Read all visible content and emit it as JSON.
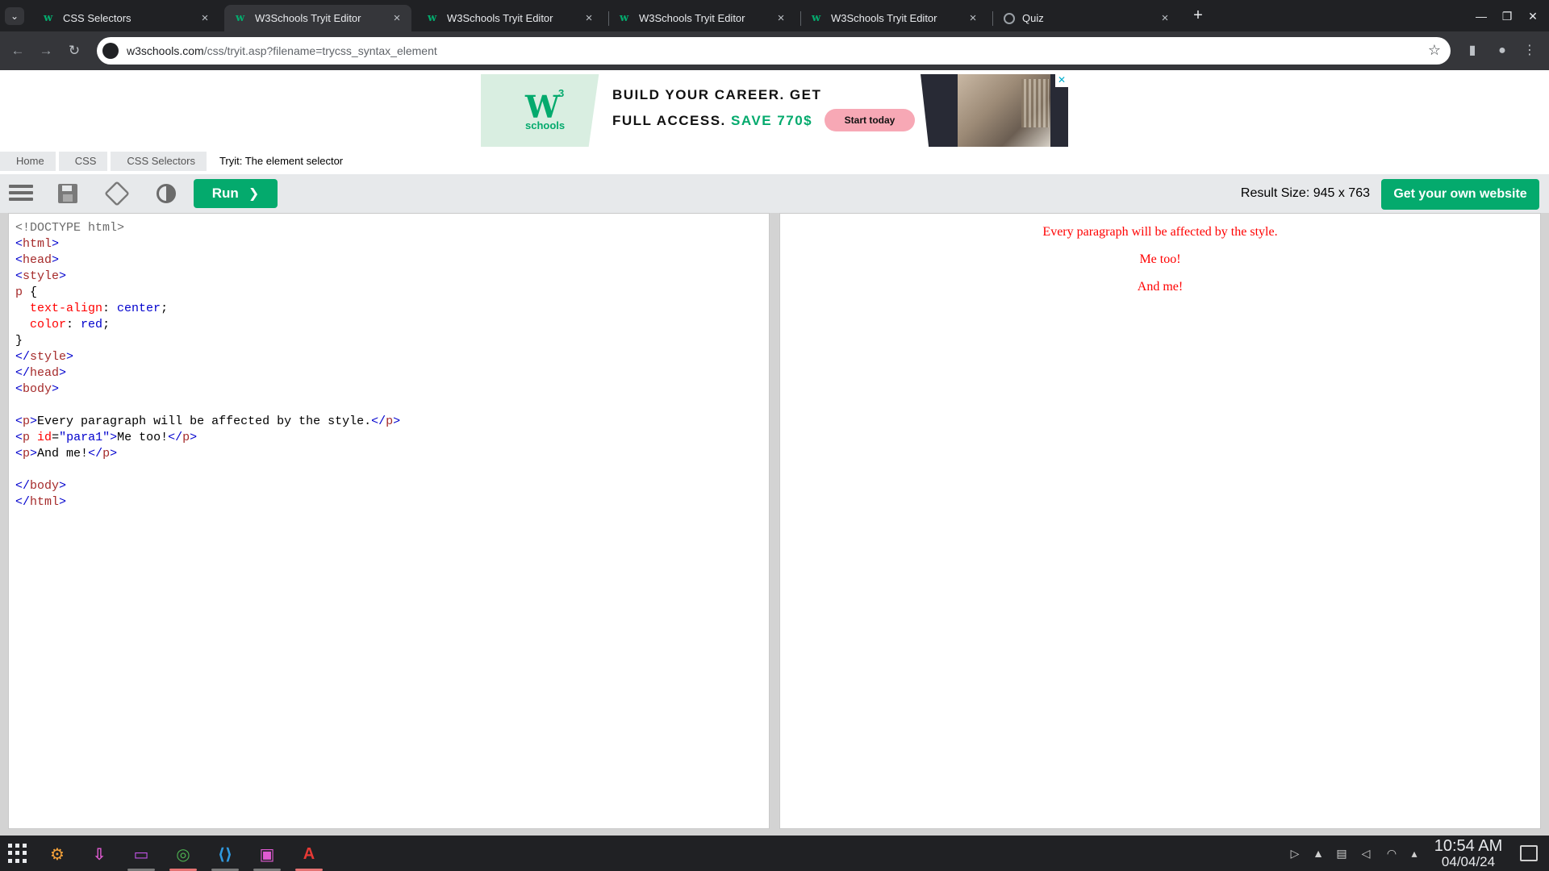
{
  "browser": {
    "tabs": [
      {
        "title": "CSS Selectors",
        "favicon": "w3schools-icon",
        "active": false
      },
      {
        "title": "W3Schools Tryit Editor",
        "favicon": "w3schools-icon",
        "active": true
      },
      {
        "title": "W3Schools Tryit Editor",
        "favicon": "w3schools-icon",
        "active": false
      },
      {
        "title": "W3Schools Tryit Editor",
        "favicon": "w3schools-icon",
        "active": false
      },
      {
        "title": "W3Schools Tryit Editor",
        "favicon": "w3schools-icon",
        "active": false
      },
      {
        "title": "Quiz",
        "favicon": "globe-icon",
        "active": false
      }
    ],
    "tab_close_glyph": "×",
    "new_tab_glyph": "+",
    "url_domain": "w3schools.com",
    "url_path": "/css/tryit.asp?filename=trycss_syntax_element"
  },
  "ad": {
    "logo_mark": "W",
    "logo_superscript": "3",
    "logo_text": "schools",
    "headline_line1": "BUILD YOUR CAREER. GET",
    "headline_line2_prefix": "FULL ACCESS.",
    "headline_line2_highlight": "SAVE 770$",
    "cta_label": "Start today",
    "close_glyph": "✕",
    "accent_color": "#04aa6d"
  },
  "breadcrumb": {
    "items": [
      "Home",
      "CSS",
      "CSS Selectors"
    ],
    "current": "Tryit: The element selector"
  },
  "tryit": {
    "run_label": "Run",
    "run_chevron": "❯",
    "result_size": "Result Size: 945 x 763",
    "get_website_label": "Get your own website",
    "brand_color": "#04aa6d"
  },
  "code": {
    "lines": [
      [
        [
          "doc",
          "<!DOCTYPE html>"
        ]
      ],
      [
        [
          "br",
          "<"
        ],
        [
          "tag",
          "html"
        ],
        [
          "br",
          ">"
        ]
      ],
      [
        [
          "br",
          "<"
        ],
        [
          "tag",
          "head"
        ],
        [
          "br",
          ">"
        ]
      ],
      [
        [
          "br",
          "<"
        ],
        [
          "tag",
          "style"
        ],
        [
          "br",
          ">"
        ]
      ],
      [
        [
          "tag",
          "p"
        ],
        [
          "plain",
          " {"
        ]
      ],
      [
        [
          "plain",
          "  "
        ],
        [
          "prop",
          "text-align"
        ],
        [
          "plain",
          ": "
        ],
        [
          "val",
          "center"
        ],
        [
          "plain",
          ";"
        ]
      ],
      [
        [
          "plain",
          "  "
        ],
        [
          "prop",
          "color"
        ],
        [
          "plain",
          ": "
        ],
        [
          "val",
          "red"
        ],
        [
          "plain",
          ";"
        ]
      ],
      [
        [
          "plain",
          "}"
        ]
      ],
      [
        [
          "br",
          "</"
        ],
        [
          "tag",
          "style"
        ],
        [
          "br",
          ">"
        ]
      ],
      [
        [
          "br",
          "</"
        ],
        [
          "tag",
          "head"
        ],
        [
          "br",
          ">"
        ]
      ],
      [
        [
          "br",
          "<"
        ],
        [
          "tag",
          "body"
        ],
        [
          "br",
          ">"
        ]
      ],
      [],
      [
        [
          "br",
          "<"
        ],
        [
          "tag",
          "p"
        ],
        [
          "br",
          ">"
        ],
        [
          "plain",
          "Every paragraph will be affected by the style."
        ],
        [
          "br",
          "</"
        ],
        [
          "tag",
          "p"
        ],
        [
          "br",
          ">"
        ]
      ],
      [
        [
          "br",
          "<"
        ],
        [
          "tag",
          "p"
        ],
        [
          "plain",
          " "
        ],
        [
          "attr",
          "id"
        ],
        [
          "plain",
          "="
        ],
        [
          "str",
          "\"para1\""
        ],
        [
          "br",
          ">"
        ],
        [
          "plain",
          "Me too!"
        ],
        [
          "br",
          "</"
        ],
        [
          "tag",
          "p"
        ],
        [
          "br",
          ">"
        ]
      ],
      [
        [
          "br",
          "<"
        ],
        [
          "tag",
          "p"
        ],
        [
          "br",
          ">"
        ],
        [
          "plain",
          "And me!"
        ],
        [
          "br",
          "</"
        ],
        [
          "tag",
          "p"
        ],
        [
          "br",
          ">"
        ]
      ],
      [],
      [
        [
          "br",
          "</"
        ],
        [
          "tag",
          "body"
        ],
        [
          "br",
          ">"
        ]
      ],
      [
        [
          "br",
          "</"
        ],
        [
          "tag",
          "html"
        ],
        [
          "br",
          ">"
        ]
      ]
    ]
  },
  "result": {
    "paragraphs": [
      "Every paragraph will be affected by the style.",
      "Me too!",
      "And me!"
    ],
    "text_color": "#ff0000"
  },
  "taskbar": {
    "apps": [
      {
        "name": "settings-app-icon",
        "glyph": "⚙",
        "color": "#f4a13a"
      },
      {
        "name": "downloads-app-icon",
        "glyph": "⇩",
        "color": "#e05bd2"
      },
      {
        "name": "files-app-icon",
        "glyph": "▭",
        "color": "#c154e6"
      },
      {
        "name": "chrome-app-icon",
        "glyph": "◎",
        "color": "#4caf50"
      },
      {
        "name": "vscode-app-icon",
        "glyph": "⟨⟩",
        "color": "#2f9ae0"
      },
      {
        "name": "image-viewer-app-icon",
        "glyph": "▣",
        "color": "#e05bd2"
      },
      {
        "name": "text-editor-app-icon",
        "glyph": "A",
        "color": "#e53935"
      }
    ],
    "time": "10:54 AM",
    "date": "04/04/24"
  }
}
